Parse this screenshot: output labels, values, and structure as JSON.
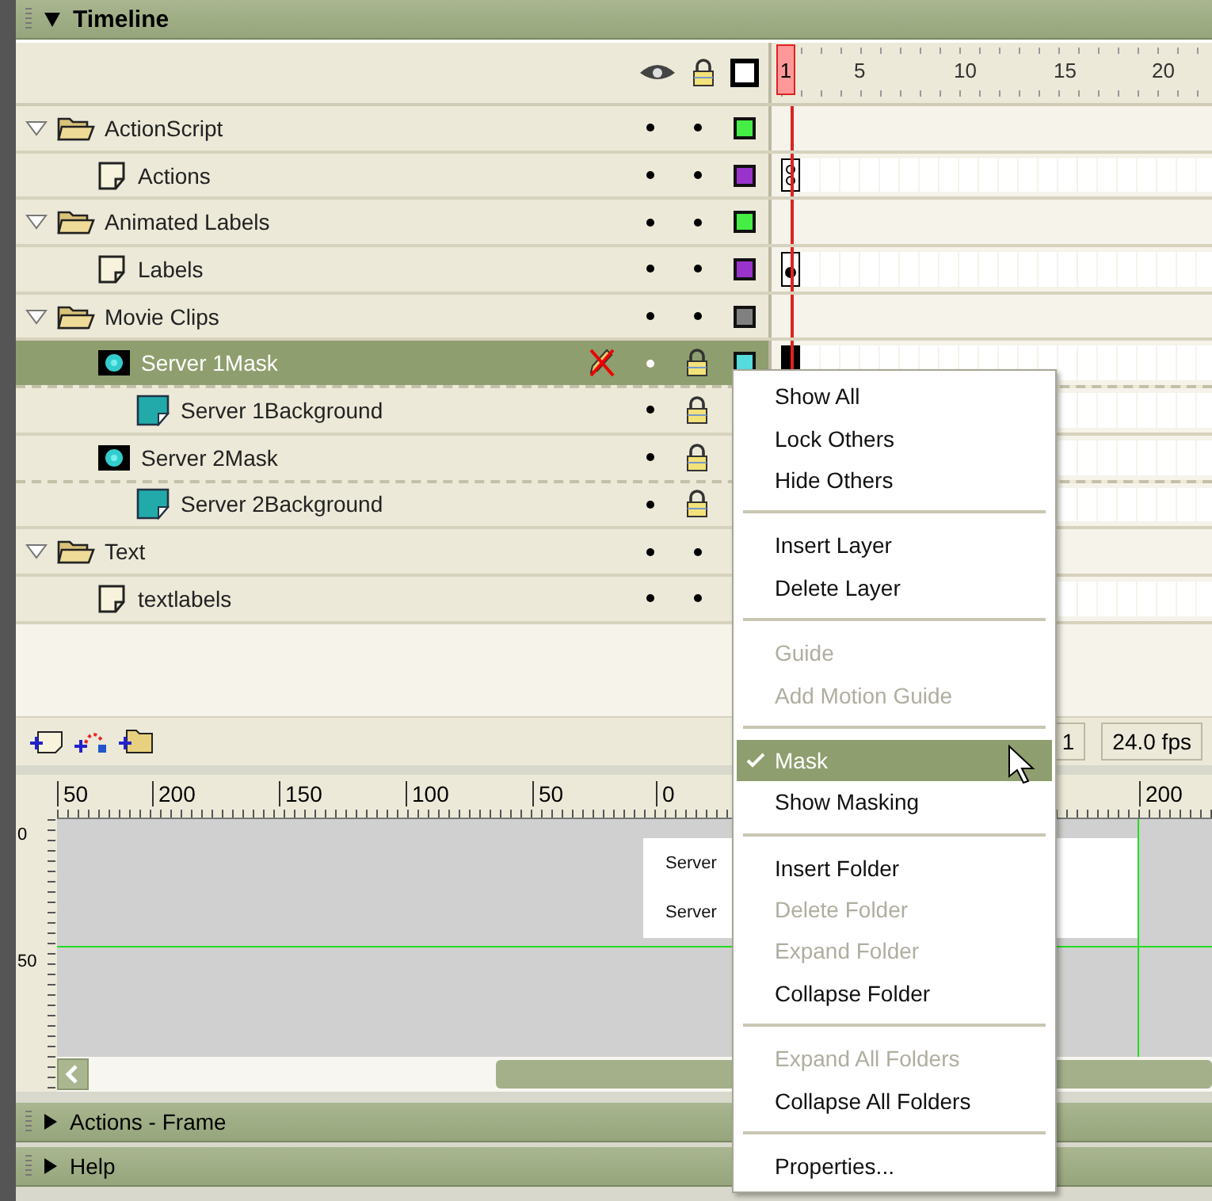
{
  "timeline": {
    "title": "Timeline",
    "expanded": true,
    "frame_ruler": [
      "1",
      "5",
      "10",
      "15",
      "20"
    ],
    "current_frame": "1",
    "fps": "24.0 fps",
    "layers": [
      {
        "name": "ActionScript",
        "kind": "folder",
        "expanded": true,
        "selected": false,
        "visible": true,
        "locked": false,
        "color": "#44ee44",
        "children": [
          {
            "name": "Actions",
            "kind": "normal",
            "selected": false,
            "visible": true,
            "locked": false,
            "color": "#9933cc",
            "first_frame": {
              "kind": "action"
            }
          }
        ]
      },
      {
        "name": "Animated Labels",
        "kind": "folder",
        "expanded": true,
        "selected": false,
        "visible": true,
        "locked": false,
        "color": "#44ee44",
        "children": [
          {
            "name": "Labels",
            "kind": "normal",
            "selected": false,
            "visible": true,
            "locked": false,
            "color": "#9933cc",
            "first_frame": {
              "kind": "label"
            }
          }
        ]
      },
      {
        "name": "Movie Clips",
        "kind": "folder",
        "expanded": true,
        "selected": false,
        "visible": true,
        "locked": false,
        "color": "#808080",
        "children": [
          {
            "name": "Server 1Mask",
            "kind": "mask",
            "selected": true,
            "visible": true,
            "locked": true,
            "editable": false,
            "color": "#55dddd",
            "first_frame": {
              "kind": "solid"
            },
            "children": [
              {
                "name": "Server 1Background",
                "kind": "masked",
                "selected": false,
                "visible": true,
                "locked": true
              }
            ]
          },
          {
            "name": "Server 2Mask",
            "kind": "mask",
            "selected": false,
            "visible": true,
            "locked": true,
            "children": [
              {
                "name": "Server 2Background",
                "kind": "masked",
                "selected": false,
                "visible": true,
                "locked": true
              }
            ]
          }
        ]
      },
      {
        "name": "Text",
        "kind": "folder",
        "expanded": true,
        "selected": false,
        "visible": true,
        "locked": false,
        "children": [
          {
            "name": "textlabels",
            "kind": "normal",
            "selected": false,
            "visible": true,
            "locked": false
          }
        ]
      }
    ]
  },
  "stage": {
    "h_ruler": [
      "50",
      "200",
      "150",
      "100",
      "50",
      "0",
      "200"
    ],
    "v_ruler": [
      "0",
      "50"
    ],
    "texts": [
      "Server",
      "Server"
    ]
  },
  "panels": [
    {
      "title": "Actions - Frame",
      "expanded": false
    },
    {
      "title": "Help",
      "expanded": false
    }
  ],
  "context_menu": [
    {
      "kind": "item",
      "label": "Show All",
      "disabled": false,
      "checked": false,
      "highlighted": false
    },
    {
      "kind": "item",
      "label": "Lock Others",
      "disabled": false,
      "checked": false,
      "highlighted": false
    },
    {
      "kind": "item",
      "label": "Hide Others",
      "disabled": false,
      "checked": false,
      "highlighted": false
    },
    {
      "kind": "separator"
    },
    {
      "kind": "item",
      "label": "Insert Layer",
      "disabled": false,
      "checked": false,
      "highlighted": false
    },
    {
      "kind": "item",
      "label": "Delete Layer",
      "disabled": false,
      "checked": false,
      "highlighted": false
    },
    {
      "kind": "separator"
    },
    {
      "kind": "item",
      "label": "Guide",
      "disabled": true,
      "checked": false,
      "highlighted": false
    },
    {
      "kind": "item",
      "label": "Add Motion Guide",
      "disabled": true,
      "checked": false,
      "highlighted": false
    },
    {
      "kind": "separator"
    },
    {
      "kind": "item",
      "label": "Mask",
      "disabled": false,
      "checked": true,
      "highlighted": true
    },
    {
      "kind": "item",
      "label": "Show Masking",
      "disabled": false,
      "checked": false,
      "highlighted": false
    },
    {
      "kind": "separator"
    },
    {
      "kind": "item",
      "label": "Insert Folder",
      "disabled": false,
      "checked": false,
      "highlighted": false
    },
    {
      "kind": "item",
      "label": "Delete Folder",
      "disabled": true,
      "checked": false,
      "highlighted": false
    },
    {
      "kind": "item",
      "label": "Expand Folder",
      "disabled": true,
      "checked": false,
      "highlighted": false
    },
    {
      "kind": "item",
      "label": "Collapse Folder",
      "disabled": false,
      "checked": false,
      "highlighted": false
    },
    {
      "kind": "separator"
    },
    {
      "kind": "item",
      "label": "Expand All Folders",
      "disabled": true,
      "checked": false,
      "highlighted": false
    },
    {
      "kind": "item",
      "label": "Collapse All Folders",
      "disabled": false,
      "checked": false,
      "highlighted": false
    },
    {
      "kind": "separator"
    },
    {
      "kind": "item",
      "label": "Properties...",
      "disabled": false,
      "checked": false,
      "highlighted": false
    }
  ]
}
